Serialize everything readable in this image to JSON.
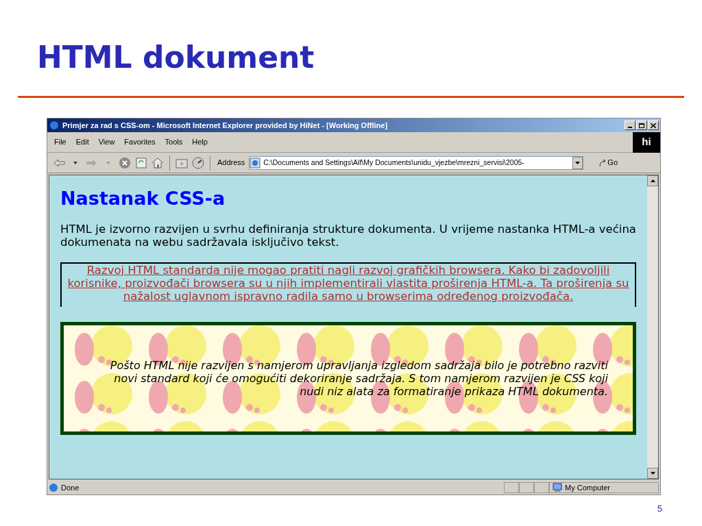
{
  "slide": {
    "title": "HTML dokument",
    "page_number": "5"
  },
  "window": {
    "title": "Primjer za rad s CSS-om - Microsoft Internet Explorer provided by HiNet - [Working Offline]"
  },
  "menu": [
    "File",
    "Edit",
    "View",
    "Favorites",
    "Tools",
    "Help"
  ],
  "brand": "hi",
  "address": {
    "label": "Address",
    "value": "C:\\Documents and Settings\\Alf\\My Documents\\unidu_vjezbe\\mrezni_servisi\\2005-",
    "go": "Go"
  },
  "page": {
    "heading": "Nastanak CSS-a",
    "intro": "HTML je izvorno razvijen u svrhu definiranja strukture dokumenta. U vrijeme nastanka HTML-a većina dokumenata na webu sadržavala isključivo tekst.",
    "boxed": "Razvoj HTML standarda nije mogao pratiti nagli razvoj grafičkih browsera. Kako bi zadovoljili korisnike, proizvođači browsera su u njih implementirali vlastita proširenja HTML-a. Ta proširenja su nažalost uglavnom ispravno radila samo u browserima određenog proizvođača.",
    "decorated": "Pošto HTML nije razvijen s namjerom upravljanja izgledom sadržaja bilo je potrebno razviti novi standard koji će omogućiti dekoriranje sadržaja. S tom namjerom razvijen je CSS koji nudi niz alata za formatiranje prikaza HTML dokumenta."
  },
  "status_bar": {
    "text": "Done",
    "zone": "My Computer"
  }
}
